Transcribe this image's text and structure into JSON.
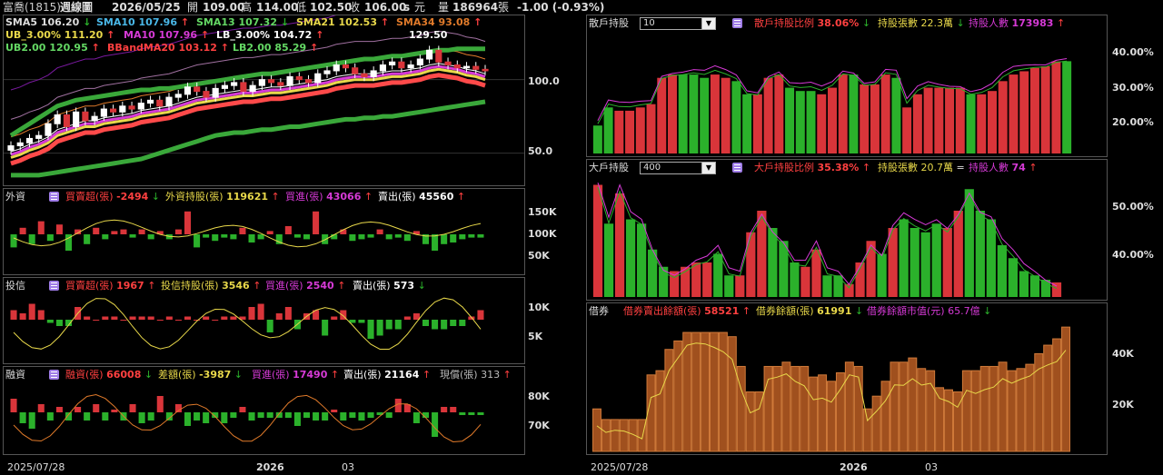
{
  "header": {
    "stock": "富喬(1815)",
    "period": "週線圖",
    "date": "2026/05/25",
    "open_label": "開",
    "open": "109.00",
    "high_label": "高",
    "high": "114.00",
    "low_label": "低",
    "low": "102.50",
    "close_label": "收",
    "close": "106.00",
    "close_flag": "s",
    "unit": "元",
    "vol_label": "量",
    "vol": "186964",
    "vol_unit": "張",
    "change": "-1.00 (-0.93%)"
  },
  "colors": {
    "up": "#d9353a",
    "down": "#2bb12b",
    "yellow": "#e8d84a",
    "magenta": "#d63ad6",
    "cyan": "#4ab8e8",
    "white": "#ffffff",
    "orange": "#e07a2a",
    "green_ind": "#64d864",
    "red_ind": "#ff3030"
  },
  "ma_labels": {
    "row1": [
      {
        "text": "SMA5 106.20",
        "arrow": "↓",
        "color": "#ffffff"
      },
      {
        "text": "SMA10 107.96",
        "arrow": "↑",
        "color": "#4ab8e8"
      },
      {
        "text": "SMA13 107.32",
        "arrow": "↓",
        "color": "#64d864"
      },
      {
        "text": "SMA21 102.53",
        "arrow": "↑",
        "color": "#e8d84a"
      },
      {
        "text": "SMA34 93.08",
        "arrow": "↑",
        "color": "#e07a2a"
      }
    ],
    "row2": [
      {
        "text": "UB_3.00% 111.20",
        "arrow": "↑",
        "color": "#e8d84a"
      },
      {
        "text": "MA10 107.96",
        "arrow": "↑",
        "color": "#d63ad6"
      },
      {
        "text": "LB_3.00% 104.72",
        "arrow": "↑",
        "color": "#ffffff"
      }
    ],
    "row3": [
      {
        "text": "UB2.00 120.95",
        "arrow": "↑",
        "color": "#64d864"
      },
      {
        "text": "BBandMA20 103.12",
        "arrow": "↑",
        "color": "#ff4040"
      },
      {
        "text": "LB2.00 85.29",
        "arrow": "↑",
        "color": "#64d864"
      }
    ],
    "peak": "129.50"
  },
  "price_axis": [
    "100.0",
    "50.0"
  ],
  "foreign": {
    "title": "外資",
    "items": [
      {
        "label": "買賣超(張)",
        "value": "-2494",
        "arrow": "↓",
        "color": "#ff4040"
      },
      {
        "label": "外資持股(張)",
        "value": "119621",
        "arrow": "↑",
        "color": "#e8d84a"
      },
      {
        "label": "買進(張)",
        "value": "43066",
        "arrow": "↑",
        "color": "#d63ad6"
      },
      {
        "label": "賣出(張)",
        "value": "45560",
        "arrow": "↑",
        "color": "#ffffff"
      }
    ],
    "axis": [
      "150K",
      "100K",
      "50K"
    ]
  },
  "trust": {
    "title": "投信",
    "items": [
      {
        "label": "買賣超(張)",
        "value": "1967",
        "arrow": "↑",
        "color": "#ff4040"
      },
      {
        "label": "投信持股(張)",
        "value": "3546",
        "arrow": "↑",
        "color": "#e8d84a"
      },
      {
        "label": "買進(張)",
        "value": "2540",
        "arrow": "↑",
        "color": "#d63ad6"
      },
      {
        "label": "賣出(張)",
        "value": "573",
        "arrow": "↓",
        "color": "#ffffff"
      }
    ],
    "axis": [
      "10K",
      "5K"
    ]
  },
  "margin": {
    "title": "融資",
    "items": [
      {
        "label": "融資(張)",
        "value": "66008",
        "arrow": "↓",
        "color": "#ff4040"
      },
      {
        "label": "差額(張)",
        "value": "-3987",
        "arrow": "↓",
        "color": "#e8d84a"
      },
      {
        "label": "買進(張)",
        "value": "17490",
        "arrow": "↑",
        "color": "#d63ad6"
      },
      {
        "label": "賣出(張)",
        "value": "21164",
        "arrow": "↑",
        "color": "#ffffff"
      },
      {
        "label": "現償(張)",
        "value": "313",
        "arrow": "↑",
        "color": "#bbbbbb"
      }
    ],
    "axis": [
      "80K",
      "70K"
    ]
  },
  "retail": {
    "title": "散戶持股",
    "select": "10",
    "items": [
      {
        "label": "散戶持股比例",
        "value": "38.06%",
        "arrow": "↓",
        "color": "#ff4040"
      },
      {
        "label": "持股張數",
        "value": "22.3萬",
        "arrow": "↓",
        "color": "#e8d84a"
      },
      {
        "label": "持股人數",
        "value": "173983",
        "arrow": "↑",
        "color": "#d63ad6"
      }
    ],
    "axis": [
      "40.00%",
      "30.00%",
      "20.00%"
    ]
  },
  "major": {
    "title": "大戶持股",
    "select": "400",
    "items": [
      {
        "label": "大戶持股比例",
        "value": "35.38%",
        "arrow": "↑",
        "color": "#ff4040"
      },
      {
        "label": "持股張數",
        "value": "20.7萬",
        "arrow": "=",
        "color": "#e8d84a"
      },
      {
        "label": "持股人數",
        "value": "74",
        "arrow": "↑",
        "color": "#d63ad6"
      }
    ],
    "axis": [
      "50.00%",
      "40.00%"
    ]
  },
  "short": {
    "title": "借券",
    "items": [
      {
        "label": "借券賣出餘額(張)",
        "value": "58521",
        "arrow": "↑",
        "color": "#ff4040"
      },
      {
        "label": "借券餘額(張)",
        "value": "61991",
        "arrow": "↓",
        "color": "#e8d84a"
      },
      {
        "label": "借券餘額市值(元)",
        "value": "65.7億",
        "arrow": "↓",
        "color": "#d63ad6"
      }
    ],
    "axis": [
      "40K",
      "20K"
    ]
  },
  "xlabels": {
    "left": [
      "2025/07/28",
      "2026",
      "03"
    ],
    "right": [
      "2025/07/28",
      "2026",
      "03"
    ]
  },
  "chart_data": [
    {
      "type": "candlestick",
      "title": "",
      "ylim": [
        30,
        135
      ],
      "close": [
        55,
        57,
        60,
        62,
        70,
        76,
        68,
        78,
        72,
        75,
        80,
        78,
        82,
        80,
        84,
        86,
        82,
        88,
        90,
        95,
        92,
        88,
        94,
        96,
        98,
        92,
        96,
        100,
        98,
        96,
        102,
        100,
        98,
        104,
        106,
        110,
        108,
        104,
        102,
        106,
        110,
        112,
        108,
        110,
        114,
        120,
        112,
        110,
        108,
        109,
        107,
        106
      ],
      "open": [
        52,
        55,
        57,
        60,
        62,
        70,
        76,
        68,
        78,
        72,
        75,
        80,
        78,
        82,
        80,
        84,
        86,
        82,
        88,
        90,
        95,
        92,
        88,
        94,
        96,
        98,
        92,
        96,
        100,
        98,
        96,
        102,
        100,
        98,
        104,
        106,
        110,
        108,
        104,
        102,
        106,
        110,
        112,
        108,
        110,
        114,
        120,
        112,
        110,
        108,
        109,
        107
      ],
      "series": [
        {
          "name": "SMA5",
          "color": "#ffffff",
          "values": [
            53,
            55,
            58,
            60,
            63,
            68,
            70,
            72,
            74,
            74,
            76,
            77,
            78,
            79,
            81,
            82,
            83,
            84,
            86,
            88,
            90,
            91,
            92,
            93,
            94,
            95,
            95,
            96,
            97,
            97,
            98,
            99,
            100,
            101,
            102,
            104,
            105,
            106,
            106,
            106,
            107,
            108,
            108,
            109,
            110,
            112,
            113,
            112,
            111,
            109,
            108,
            106
          ]
        },
        {
          "name": "UB2.00",
          "color": "#3aa83a",
          "values": [
            62,
            66,
            70,
            74,
            78,
            82,
            84,
            86,
            87,
            88,
            89,
            90,
            91,
            92,
            93,
            93,
            94,
            94,
            95,
            96,
            97,
            98,
            99,
            100,
            101,
            102,
            103,
            104,
            104,
            105,
            106,
            107,
            108,
            109,
            110,
            111,
            112,
            113,
            114,
            114,
            115,
            116,
            116,
            117,
            118,
            119,
            120,
            120,
            121,
            121,
            121,
            121
          ]
        },
        {
          "name": "LB2.00",
          "color": "#3aa83a",
          "values": [
            35,
            35,
            35,
            35,
            36,
            37,
            38,
            39,
            40,
            41,
            42,
            43,
            44,
            45,
            46,
            48,
            50,
            52,
            54,
            56,
            58,
            60,
            62,
            63,
            64,
            64,
            65,
            66,
            66,
            67,
            68,
            68,
            69,
            70,
            71,
            72,
            73,
            73,
            74,
            74,
            75,
            75,
            76,
            77,
            78,
            79,
            80,
            81,
            82,
            83,
            84,
            85
          ]
        }
      ]
    },
    {
      "type": "bar",
      "title": "外資買賣超",
      "values": [
        -8,
        4,
        -6,
        8,
        -4,
        6,
        -10,
        3,
        -6,
        4,
        -3,
        2,
        3,
        -2,
        3,
        -3,
        2,
        -3,
        3,
        14,
        -8,
        -2,
        -4,
        -2,
        -3,
        4,
        -5,
        -3,
        2,
        -6,
        5,
        -2,
        -3,
        14,
        -6,
        -3,
        3,
        -4,
        -3,
        -2,
        3,
        -3,
        -2,
        -4,
        2,
        -6,
        -10,
        -6,
        -5,
        -3,
        -2,
        -2
      ]
    },
    {
      "type": "bar",
      "title": "投信買賣超",
      "values": [
        3,
        2,
        5,
        3,
        -1,
        -2,
        -2,
        4,
        1,
        0,
        1,
        1,
        0,
        1,
        1,
        1,
        0,
        1,
        0,
        1,
        0,
        1,
        0,
        1,
        1,
        1,
        4,
        5,
        -4,
        2,
        4,
        -3,
        2,
        3,
        -5,
        1,
        3,
        -1,
        -1,
        -6,
        -5,
        -3,
        -3,
        1,
        2,
        -2,
        -3,
        -3,
        -2,
        -2,
        1,
        3
      ]
    },
    {
      "type": "bar",
      "title": "融資差額",
      "values": [
        5,
        -4,
        -6,
        3,
        -3,
        2,
        -3,
        2,
        -3,
        3,
        -3,
        1,
        -3,
        3,
        -4,
        -3,
        6,
        -3,
        3,
        -5,
        -3,
        -4,
        -2,
        -4,
        -2,
        2,
        -3,
        -2,
        -2,
        -2,
        -2,
        -5,
        -2,
        -3,
        -3,
        1,
        -3,
        -2,
        -3,
        -2,
        -1,
        -2,
        5,
        3,
        -4,
        -2,
        -9,
        2,
        2,
        -1,
        -1,
        -1
      ]
    },
    {
      "type": "bar",
      "title": "散戶持股比例",
      "ylim": [
        10,
        47
      ],
      "values": [
        18.5,
        24,
        23,
        23,
        24,
        25,
        33,
        34,
        34,
        34,
        33,
        34,
        33,
        32,
        28,
        28,
        33,
        34,
        30,
        29,
        29,
        28,
        30,
        34,
        34,
        31,
        31,
        34,
        33,
        24,
        28,
        30,
        30,
        30,
        30,
        28,
        28,
        29,
        32,
        34,
        35,
        36,
        36.5,
        38,
        38.06
      ],
      "up": [
        0,
        0,
        1,
        1,
        1,
        1,
        1,
        1,
        0,
        0,
        0,
        1,
        1,
        0,
        0,
        1,
        1,
        1,
        0,
        0,
        0,
        1,
        1,
        1,
        0,
        1,
        1,
        1,
        0,
        1,
        1,
        1,
        1,
        1,
        1,
        0,
        1,
        1,
        1,
        1,
        1,
        1,
        1,
        1,
        0
      ]
    },
    {
      "type": "bar",
      "title": "大戶持股比例",
      "ylim": [
        32,
        60
      ],
      "values": [
        58,
        49,
        56,
        50,
        49,
        43,
        39,
        38,
        39,
        40,
        40,
        42,
        37,
        37,
        47,
        52,
        48,
        45,
        40,
        39,
        43,
        37,
        37,
        35,
        40,
        45,
        42,
        48,
        50,
        48,
        47,
        49,
        48,
        52,
        57,
        52,
        50,
        44,
        41,
        38,
        37,
        36,
        35.38
      ],
      "up": [
        1,
        0,
        1,
        0,
        0,
        0,
        0,
        1,
        1,
        1,
        1,
        0,
        0,
        1,
        1,
        1,
        0,
        0,
        0,
        1,
        1,
        0,
        0,
        1,
        1,
        1,
        0,
        1,
        0,
        0,
        0,
        0,
        1,
        1,
        0,
        0,
        0,
        0,
        0,
        0,
        0,
        0,
        1
      ]
    },
    {
      "type": "bar",
      "title": "借券賣出餘額",
      "ylim": [
        0,
        62000
      ],
      "values": [
        20000,
        15000,
        15000,
        15000,
        15000,
        15000,
        36000,
        38000,
        48000,
        52000,
        56000,
        56000,
        56000,
        56000,
        56000,
        54000,
        40000,
        28000,
        28000,
        40000,
        40000,
        42000,
        40000,
        40000,
        35000,
        36000,
        33000,
        37000,
        42000,
        40000,
        20000,
        26000,
        33000,
        42000,
        42000,
        44000,
        39000,
        38000,
        30000,
        29000,
        28000,
        38000,
        38000,
        40000,
        40000,
        42000,
        38000,
        39000,
        41000,
        46000,
        50000,
        53000,
        58521
      ]
    }
  ]
}
